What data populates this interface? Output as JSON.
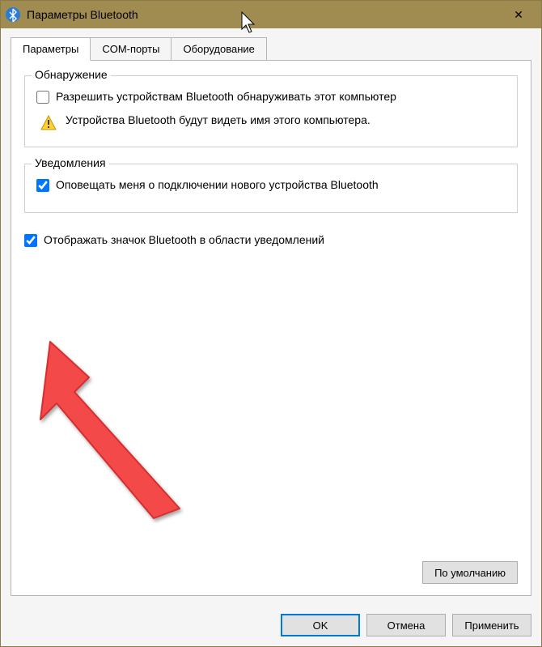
{
  "window": {
    "title": "Параметры Bluetooth"
  },
  "tabs": {
    "0": {
      "label": "Параметры"
    },
    "1": {
      "label": "COM-порты"
    },
    "2": {
      "label": "Оборудование"
    }
  },
  "group_discovery": {
    "legend": "Обнаружение",
    "allow_discovery_label": "Разрешить устройствам Bluetooth обнаруживать этот компьютер",
    "info_text": "Устройства Bluetooth будут видеть имя этого компьютера."
  },
  "group_notifications": {
    "legend": "Уведомления",
    "notify_label": "Оповещать меня о подключении нового устройства Bluetooth"
  },
  "show_tray_label": "Отображать значок Bluetooth в области уведомлений",
  "buttons": {
    "defaults": "По умолчанию",
    "ok": "OK",
    "cancel": "Отмена",
    "apply": "Применить"
  }
}
